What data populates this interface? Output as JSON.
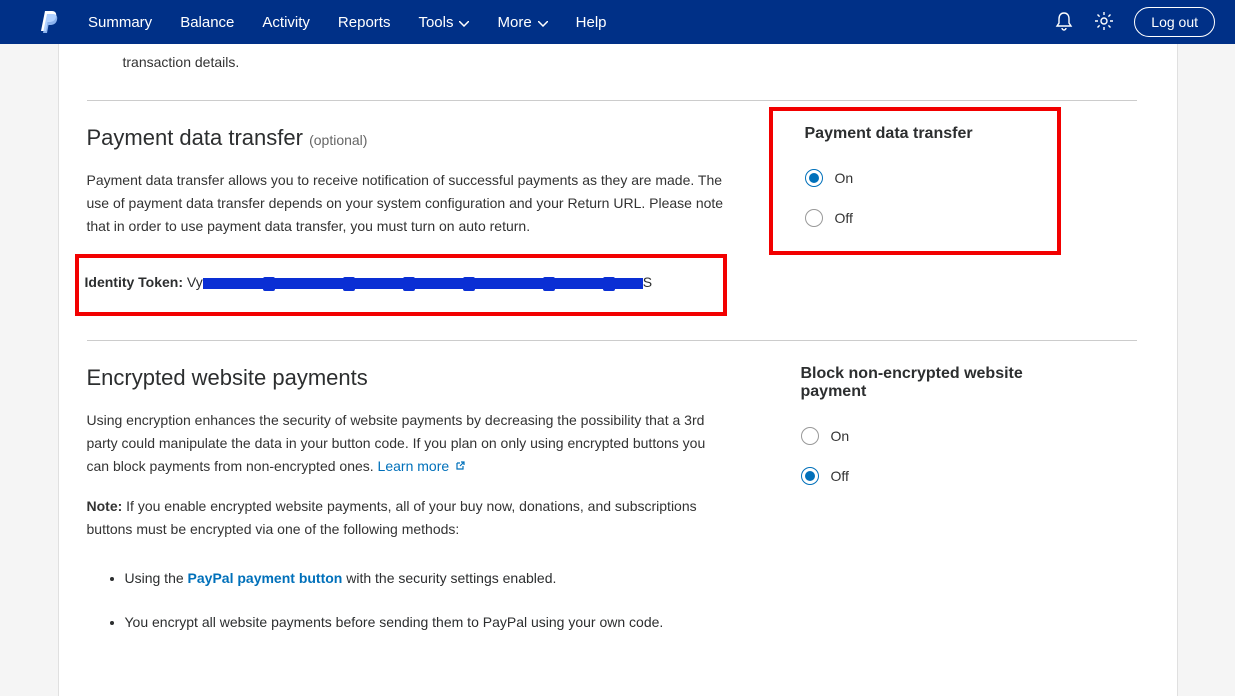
{
  "nav": {
    "items": [
      {
        "label": "Summary"
      },
      {
        "label": "Balance"
      },
      {
        "label": "Activity"
      },
      {
        "label": "Reports"
      },
      {
        "label": "Tools",
        "dropdown": true
      },
      {
        "label": "More",
        "dropdown": true
      },
      {
        "label": "Help"
      }
    ],
    "logout": "Log out"
  },
  "prev_fragment": "transaction details.",
  "pdt": {
    "title": "Payment data transfer",
    "optional": "(optional)",
    "body": "Payment data transfer allows you to receive notification of successful payments as they are made. The use of payment data transfer depends on your system configuration and your Return URL. Please note that in order to use payment data transfer, you must turn on auto return.",
    "identity_label": "Identity Token:",
    "token_prefix": "Vy",
    "token_suffix": "S",
    "right_heading": "Payment data transfer",
    "on_label": "On",
    "off_label": "Off",
    "selected": "on"
  },
  "ewp": {
    "title": "Encrypted website payments",
    "body": "Using encryption enhances the security of website payments by decreasing the possibility that a 3rd party could manipulate the data in your button code. If you plan on only using encrypted buttons you can block payments from non-encrypted ones.",
    "learn_more": "Learn more",
    "note_label": "Note:",
    "note_body": "If you enable encrypted website payments, all of your buy now, donations, and subscriptions buttons must be encrypted via one of the following methods:",
    "bullets": [
      {
        "prefix": "Using the ",
        "link": "PayPal payment button",
        "suffix": " with the security settings enabled."
      },
      {
        "prefix": "You encrypt all website payments before sending them to PayPal using your own code.",
        "link": "",
        "suffix": ""
      }
    ],
    "right_heading": "Block non-encrypted website payment",
    "on_label": "On",
    "off_label": "Off",
    "selected": "off"
  }
}
